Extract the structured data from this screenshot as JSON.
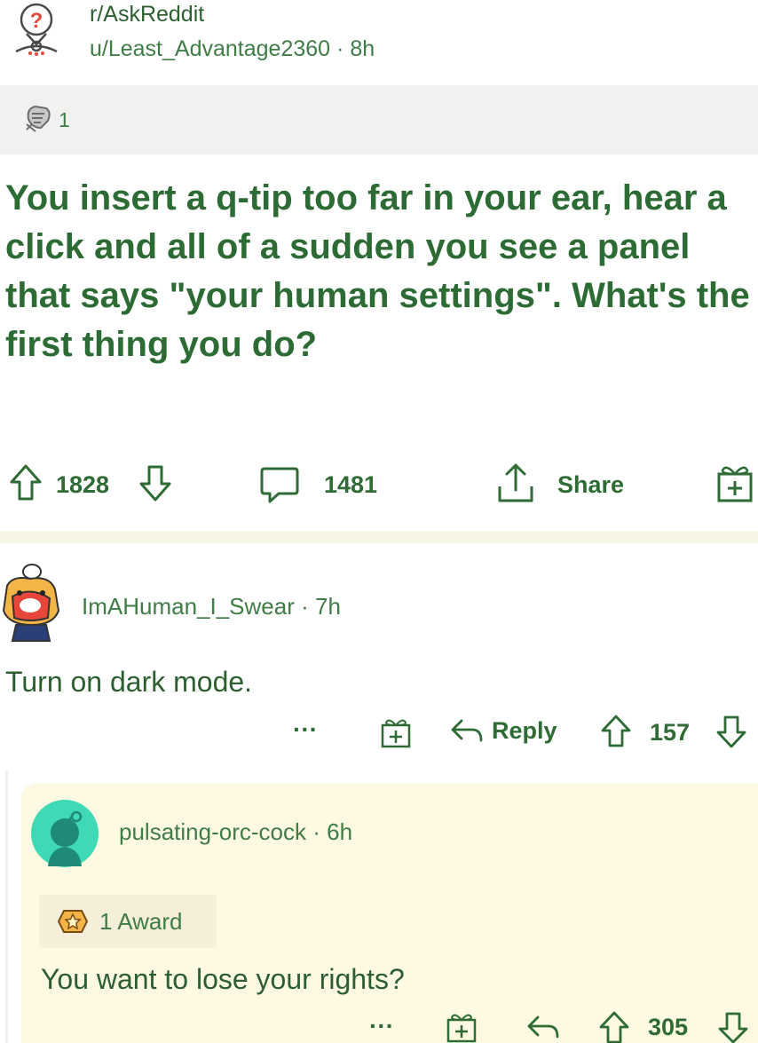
{
  "post": {
    "subreddit": "r/AskReddit",
    "author": "u/Least_Advantage2360",
    "age": "8h",
    "award_count": "1",
    "title": "You insert a q-tip too far in your ear, hear a click and all of a sudden you see a panel that says \"your human settings\". What's the first thing you do?",
    "upvotes": "1828",
    "comments": "1481",
    "share_label": "Share"
  },
  "comment1": {
    "author": "ImAHuman_I_Swear",
    "age": "7h",
    "body": "Turn on dark mode.",
    "more_label": "···",
    "reply_label": "Reply",
    "votes": "157"
  },
  "comment2": {
    "author": "pulsating-orc-cock",
    "age": "6h",
    "award_label": "1 Award",
    "body": "You want to lose your rights?",
    "more_label": "···",
    "votes": "305"
  },
  "colors": {
    "text_green": "#2f6b34",
    "award_band": "#f1f2f0",
    "nested_bg": "#fdf9e2",
    "avatar_teal": "#3fd9b6"
  },
  "icons": [
    "subreddit-icon",
    "award-icon",
    "upvote-icon",
    "downvote-icon",
    "comment-icon",
    "share-icon",
    "gift-icon",
    "reply-icon",
    "more-icon"
  ]
}
